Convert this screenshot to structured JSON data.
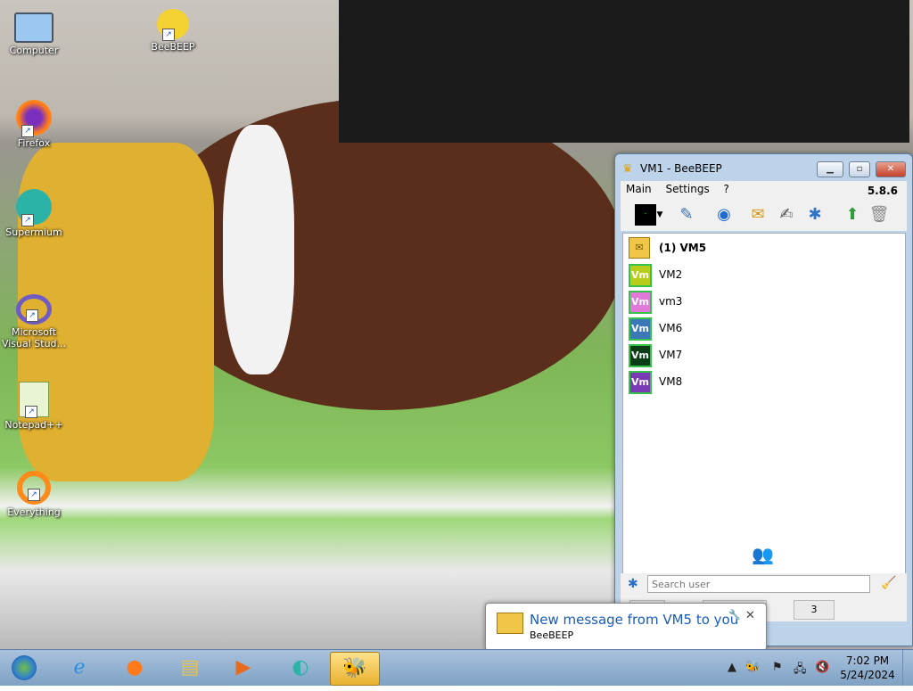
{
  "desktop": {
    "icons": [
      {
        "label": "Computer",
        "icon": "computer-icon"
      },
      {
        "label": "BeeBEEP",
        "icon": "bee-icon"
      },
      {
        "label": "Firefox",
        "icon": "firefox-icon"
      },
      {
        "label": "Supermium",
        "icon": "supermium-icon"
      },
      {
        "label": "Microsoft Visual Stud...",
        "icon": "visual-studio-icon"
      },
      {
        "label": "Notepad++",
        "icon": "notepadpp-icon"
      },
      {
        "label": "Everything",
        "icon": "everything-icon"
      }
    ]
  },
  "window": {
    "title": "VM1 - BeeBEEP",
    "menu": {
      "main": "Main",
      "settings": "Settings",
      "help": "?"
    },
    "version": "5.8.6",
    "users": [
      {
        "name": "(1) VM5",
        "avatar": "message-icon",
        "bold": true,
        "color": "#f0c649"
      },
      {
        "name": "VM2",
        "avatar_text": "Vm",
        "color": "#b8cc1a"
      },
      {
        "name": "vm3",
        "avatar_text": "Vm",
        "color": "#e07ad8"
      },
      {
        "name": "VM6",
        "avatar_text": "Vm",
        "color": "#3b78b8"
      },
      {
        "name": "VM7",
        "avatar_text": "Vm",
        "color": "#0d3d16"
      },
      {
        "name": "VM8",
        "avatar_text": "Vm",
        "color": "#7b3bb5"
      }
    ],
    "search_placeholder": "Search user",
    "tab_count": "3"
  },
  "notification": {
    "title": "New message from VM5 to you",
    "subtitle": "BeeBEEP"
  },
  "taskbar": {
    "time": "7:02 PM",
    "date": "5/24/2024"
  }
}
